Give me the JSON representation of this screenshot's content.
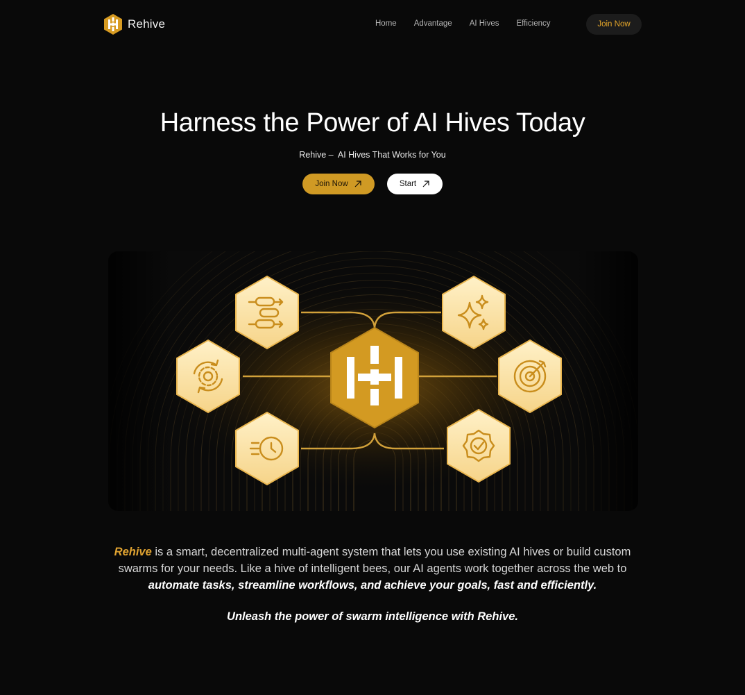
{
  "brand": {
    "name": "Rehive",
    "accent_color": "#d09a24",
    "logo_icon": "hexagon-logo-icon"
  },
  "nav": {
    "links": [
      "Home",
      "Advantage",
      "AI Hives",
      "Efficiency"
    ],
    "cta_label": "Join Now"
  },
  "hero": {
    "title": "Harness the Power of AI Hives Today",
    "subtitle": "Rehive –  AI Hives That Works for You",
    "primary_label": "Join Now",
    "secondary_label": "Start",
    "button_icon": "arrow-up-right-icon"
  },
  "illustration": {
    "center_icon": "rehive-hexagon-logo-icon",
    "nodes": [
      {
        "icon": "workflow-icon"
      },
      {
        "icon": "sparkles-icon"
      },
      {
        "icon": "gear-refresh-icon"
      },
      {
        "icon": "target-icon"
      },
      {
        "icon": "fast-clock-icon"
      },
      {
        "icon": "verified-badge-icon"
      }
    ]
  },
  "description": {
    "brand_word": "Rehive",
    "line1_rest": " is a smart, decentralized multi-agent system that lets you use existing AI hives or build custom swarms for your needs. Like a hive of intelligent bees, our AI agents work together across the web to ",
    "emphasis": "automate tasks, streamline workflows, and achieve your goals, fast and efficiently.",
    "tagline": "Unleash the power of swarm intelligence with Rehive."
  }
}
